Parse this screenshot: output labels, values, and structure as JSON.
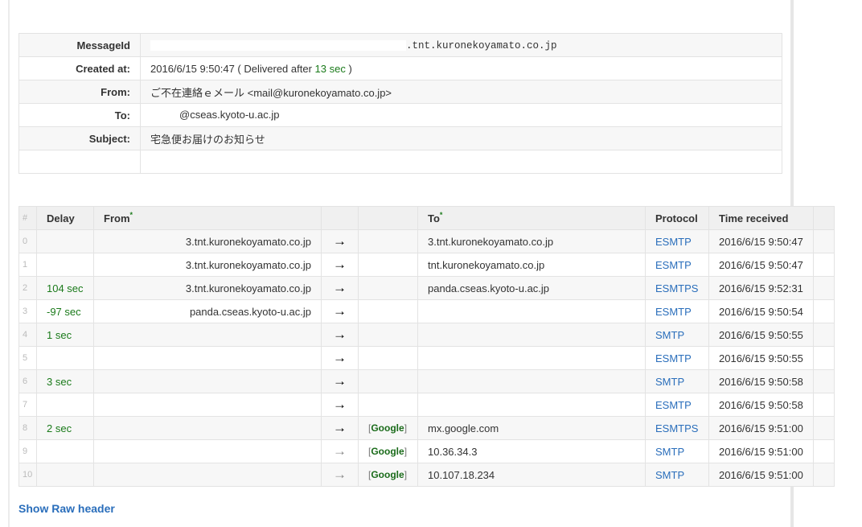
{
  "summary": {
    "messageid_label": "MessageId",
    "messageid_value": ".tnt.kuronekoyamato.co.jp",
    "created_label": "Created at:",
    "created_value": "2016/6/15 9:50:47 ( Delivered after ",
    "created_delay": "13 sec",
    "created_suffix": " )",
    "from_label": "From:",
    "from_value": "ご不在連絡ｅメール <mail@kuronekoyamato.co.jp>",
    "to_label": "To:",
    "to_value": "@cseas.kyoto-u.ac.jp",
    "subject_label": "Subject:",
    "subject_value": "宅急便お届けのお知らせ"
  },
  "hops": {
    "headers": {
      "num": "#",
      "delay": "Delay",
      "from": "From",
      "to": "To",
      "protocol": "Protocol",
      "time": "Time received",
      "star": "*"
    },
    "rows": [
      {
        "num": "0",
        "delay": "",
        "from": "3.tnt.kuronekoyamato.co.jp",
        "tag": "",
        "to": "3.tnt.kuronekoyamato.co.jp",
        "protocol": "ESMTP",
        "time": "2016/6/15 9:50:47",
        "arrow": "→"
      },
      {
        "num": "1",
        "delay": "",
        "from": "3.tnt.kuronekoyamato.co.jp",
        "tag": "",
        "to": "tnt.kuronekoyamato.co.jp",
        "protocol": "ESMTP",
        "time": "2016/6/15 9:50:47",
        "arrow": "→"
      },
      {
        "num": "2",
        "delay": "104 sec",
        "from": "3.tnt.kuronekoyamato.co.jp",
        "tag": "",
        "to": "panda.cseas.kyoto-u.ac.jp",
        "protocol": "ESMTPS",
        "time": "2016/6/15 9:52:31",
        "arrow": "→"
      },
      {
        "num": "3",
        "delay": "-97 sec",
        "from": "panda.cseas.kyoto-u.ac.jp",
        "tag": "",
        "to": "",
        "protocol": "ESMTP",
        "time": "2016/6/15 9:50:54",
        "arrow": "→"
      },
      {
        "num": "4",
        "delay": "1 sec",
        "from": "",
        "tag": "",
        "to": "",
        "protocol": "SMTP",
        "time": "2016/6/15 9:50:55",
        "arrow": "→"
      },
      {
        "num": "5",
        "delay": "",
        "from": "",
        "tag": "",
        "to": "",
        "protocol": "ESMTP",
        "time": "2016/6/15 9:50:55",
        "arrow": "→"
      },
      {
        "num": "6",
        "delay": "3 sec",
        "from": "",
        "tag": "",
        "to": "",
        "protocol": "SMTP",
        "time": "2016/6/15 9:50:58",
        "arrow": "→"
      },
      {
        "num": "7",
        "delay": "",
        "from": "",
        "tag": "",
        "to": "",
        "protocol": "ESMTP",
        "time": "2016/6/15 9:50:58",
        "arrow": "→"
      },
      {
        "num": "8",
        "delay": "2 sec",
        "from": "",
        "tag": "Google",
        "to": "mx.google.com",
        "protocol": "ESMTPS",
        "time": "2016/6/15 9:51:00",
        "arrow": "→"
      },
      {
        "num": "9",
        "delay": "",
        "from": "",
        "tag": "Google",
        "to": "10.36.34.3",
        "protocol": "SMTP",
        "time": "2016/6/15 9:51:00",
        "arrow": "→"
      },
      {
        "num": "10",
        "delay": "",
        "from": "",
        "tag": "Google",
        "to": "10.107.18.234",
        "protocol": "SMTP",
        "time": "2016/6/15 9:51:00",
        "arrow": "→"
      }
    ]
  },
  "show_raw_label": "Show Raw header"
}
